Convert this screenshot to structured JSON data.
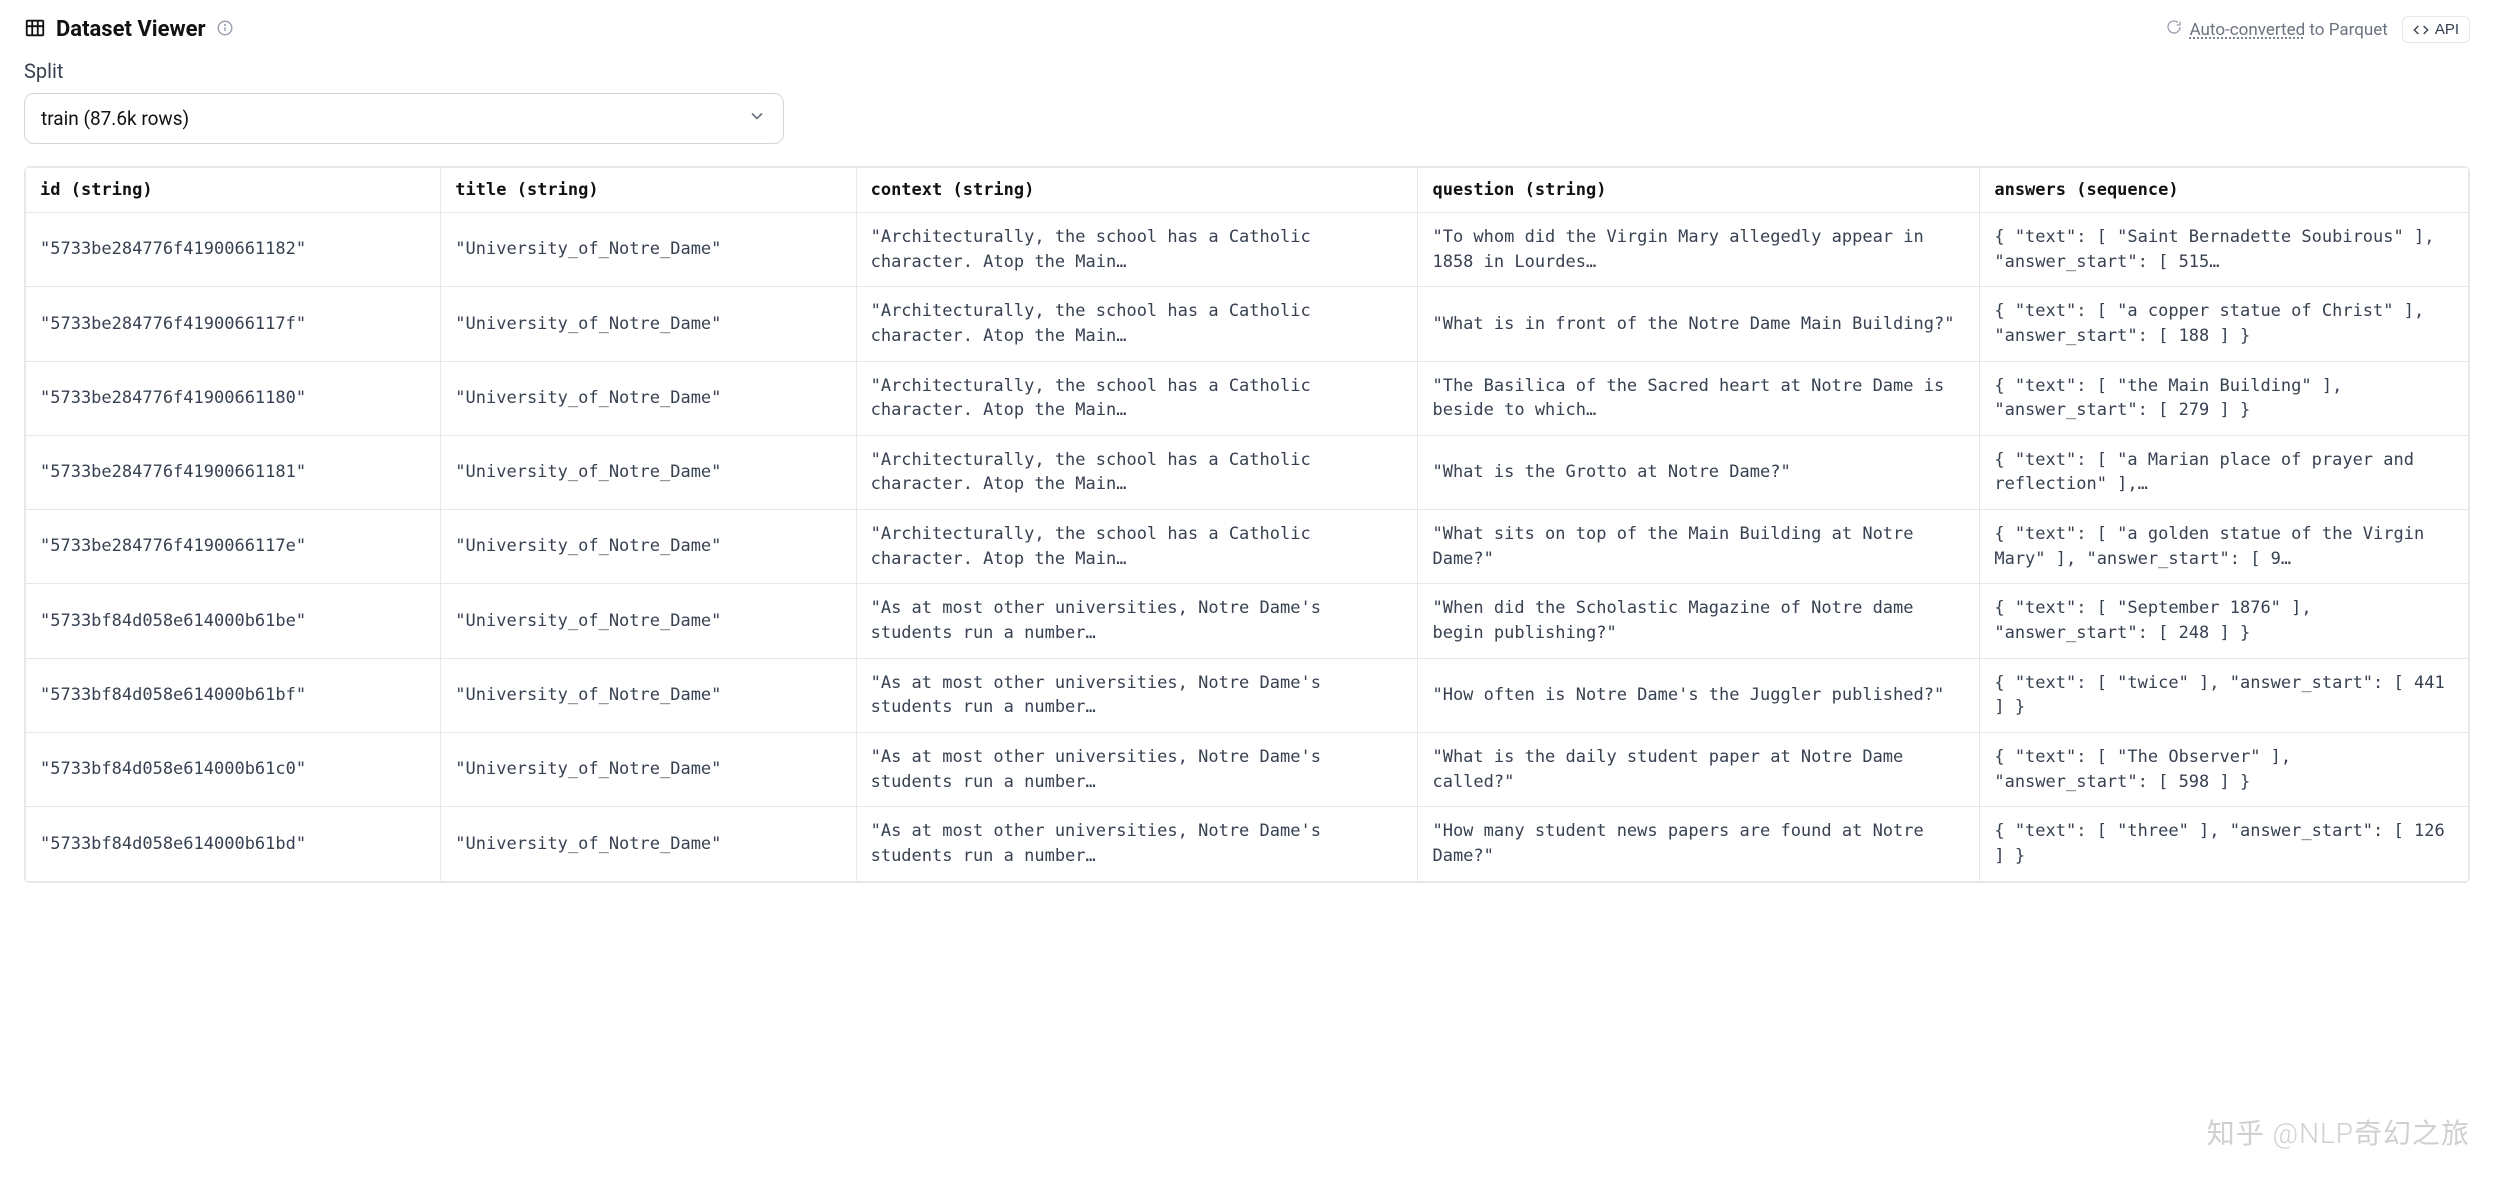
{
  "header": {
    "title": "Dataset Viewer",
    "auto_conv_prefix_link": "Auto-converted",
    "auto_conv_suffix": " to Parquet",
    "api_label": "API"
  },
  "split": {
    "label": "Split",
    "selected": "train (87.6k rows)"
  },
  "columns": [
    {
      "name": "id",
      "type": "string"
    },
    {
      "name": "title",
      "type": "string"
    },
    {
      "name": "context",
      "type": "string"
    },
    {
      "name": "question",
      "type": "string"
    },
    {
      "name": "answers",
      "type": "sequence"
    }
  ],
  "rows": [
    {
      "id": "\"5733be284776f41900661182\"",
      "title": "\"University_of_Notre_Dame\"",
      "context": "\"Architecturally, the school has a Catholic character. Atop the Main…",
      "question": "\"To whom did the Virgin Mary allegedly appear in 1858 in Lourdes…",
      "answers": "{ \"text\": [ \"Saint Bernadette Soubirous\" ], \"answer_start\": [ 515…"
    },
    {
      "id": "\"5733be284776f4190066117f\"",
      "title": "\"University_of_Notre_Dame\"",
      "context": "\"Architecturally, the school has a Catholic character. Atop the Main…",
      "question": "\"What is in front of the Notre Dame Main Building?\"",
      "answers": "{ \"text\": [ \"a copper statue of Christ\" ], \"answer_start\": [ 188 ] }"
    },
    {
      "id": "\"5733be284776f41900661180\"",
      "title": "\"University_of_Notre_Dame\"",
      "context": "\"Architecturally, the school has a Catholic character. Atop the Main…",
      "question": "\"The Basilica of the Sacred heart at Notre Dame is beside to which…",
      "answers": "{ \"text\": [ \"the Main Building\" ], \"answer_start\": [ 279 ] }"
    },
    {
      "id": "\"5733be284776f41900661181\"",
      "title": "\"University_of_Notre_Dame\"",
      "context": "\"Architecturally, the school has a Catholic character. Atop the Main…",
      "question": "\"What is the Grotto at Notre Dame?\"",
      "answers": "{ \"text\": [ \"a Marian place of prayer and reflection\" ],…"
    },
    {
      "id": "\"5733be284776f4190066117e\"",
      "title": "\"University_of_Notre_Dame\"",
      "context": "\"Architecturally, the school has a Catholic character. Atop the Main…",
      "question": "\"What sits on top of the Main Building at Notre Dame?\"",
      "answers": "{ \"text\": [ \"a golden statue of the Virgin Mary\" ], \"answer_start\": [ 9…"
    },
    {
      "id": "\"5733bf84d058e614000b61be\"",
      "title": "\"University_of_Notre_Dame\"",
      "context": "\"As at most other universities, Notre Dame's students run a number…",
      "question": "\"When did the Scholastic Magazine of Notre dame begin publishing?\"",
      "answers": "{ \"text\": [ \"September 1876\" ], \"answer_start\": [ 248 ] }"
    },
    {
      "id": "\"5733bf84d058e614000b61bf\"",
      "title": "\"University_of_Notre_Dame\"",
      "context": "\"As at most other universities, Notre Dame's students run a number…",
      "question": "\"How often is Notre Dame's the Juggler published?\"",
      "answers": "{ \"text\": [ \"twice\" ], \"answer_start\": [ 441 ] }"
    },
    {
      "id": "\"5733bf84d058e614000b61c0\"",
      "title": "\"University_of_Notre_Dame\"",
      "context": "\"As at most other universities, Notre Dame's students run a number…",
      "question": "\"What is the daily student paper at Notre Dame called?\"",
      "answers": "{ \"text\": [ \"The Observer\" ], \"answer_start\": [ 598 ] }"
    },
    {
      "id": "\"5733bf84d058e614000b61bd\"",
      "title": "\"University_of_Notre_Dame\"",
      "context": "\"As at most other universities, Notre Dame's students run a number…",
      "question": "\"How many student news papers are found at Notre Dame?\"",
      "answers": "{ \"text\": [ \"three\" ], \"answer_start\": [ 126 ] }"
    }
  ],
  "watermark": "知乎 @NLP奇幻之旅"
}
